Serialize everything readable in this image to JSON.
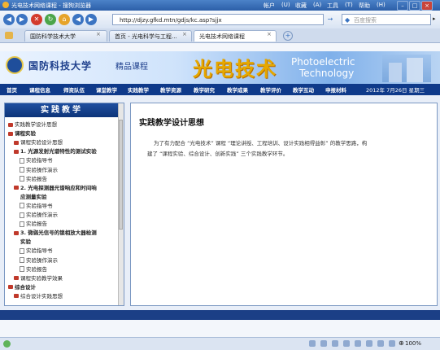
{
  "window": {
    "title": "光电技术网络课程 - 搜狗浏览器",
    "menu": [
      "帐户",
      "(U)",
      "收藏",
      "(A)",
      "工具",
      "(T)",
      "帮助",
      "(H)"
    ]
  },
  "nav": {
    "address": "http://djzy.gfkd.mtn/gdjs/kc.asp?sjjx",
    "search_placeholder": "百度搜索"
  },
  "tabs": [
    {
      "label": "国防科学技术大学"
    },
    {
      "label": "首页 - 光电科学与工程..."
    },
    {
      "label": "光电技术网络课程"
    }
  ],
  "banner": {
    "university": "国防科技大学",
    "course_type": "精品课程",
    "course_title": "光电技术",
    "english_line1": "Photoelectric",
    "english_line2": "Technology"
  },
  "main_nav": {
    "items": [
      "首页",
      "课程信息",
      "师资队伍",
      "课堂教学",
      "实践教学",
      "教学资源",
      "教学研究",
      "教学成果",
      "教学评价",
      "教学互动",
      "申报材料"
    ],
    "date": "2012年 7月26日 星期三"
  },
  "sidebar": {
    "heading": "实践教学",
    "tree": [
      {
        "label": "实践教学设计思想",
        "level": 0,
        "kind": "book",
        "bold": false
      },
      {
        "label": "课程实验",
        "level": 0,
        "kind": "book",
        "bold": true
      },
      {
        "label": "课程实验设计思想",
        "level": 1,
        "kind": "book",
        "bold": false
      },
      {
        "label": "1. 光源发射光谱特性的测试实验",
        "level": 1,
        "kind": "book",
        "bold": true
      },
      {
        "label": "实验指导书",
        "level": 2,
        "kind": "doc",
        "bold": false
      },
      {
        "label": "实验操作演示",
        "level": 2,
        "kind": "doc",
        "bold": false
      },
      {
        "label": "实验报告",
        "level": 2,
        "kind": "doc",
        "bold": false
      },
      {
        "label": "2. 光电探测器光谱响应和时间响",
        "level": 1,
        "kind": "book",
        "bold": true
      },
      {
        "label": "应测量实验",
        "level": 1,
        "kind": "cont",
        "bold": true
      },
      {
        "label": "实验指导书",
        "level": 2,
        "kind": "doc",
        "bold": false
      },
      {
        "label": "实验操作演示",
        "level": 2,
        "kind": "doc",
        "bold": false
      },
      {
        "label": "实验报告",
        "level": 2,
        "kind": "doc",
        "bold": false
      },
      {
        "label": "3. 微弱光信号的锁相放大器检测",
        "level": 1,
        "kind": "book",
        "bold": true
      },
      {
        "label": "实验",
        "level": 1,
        "kind": "cont",
        "bold": true
      },
      {
        "label": "实验指导书",
        "level": 2,
        "kind": "doc",
        "bold": false
      },
      {
        "label": "实验操作演示",
        "level": 2,
        "kind": "doc",
        "bold": false
      },
      {
        "label": "实验报告",
        "level": 2,
        "kind": "doc",
        "bold": false
      },
      {
        "label": "课程实验教学效果",
        "level": 1,
        "kind": "book",
        "bold": false
      },
      {
        "label": "综合设计",
        "level": 0,
        "kind": "book",
        "bold": true
      },
      {
        "label": "综合设计实践思想",
        "level": 1,
        "kind": "book",
        "bold": false
      }
    ]
  },
  "content": {
    "title": "实践教学设计思想",
    "para_line1": "为了有力配合 “光电技术” 课程 “理论讲授、工程培训、设计实践相得益彰” 的教学思路，构",
    "para_line2": "建了 “课程实验、综合设计、创新实践” 三个实践教学环节。"
  },
  "statusbar": {
    "zoom": "100%"
  }
}
